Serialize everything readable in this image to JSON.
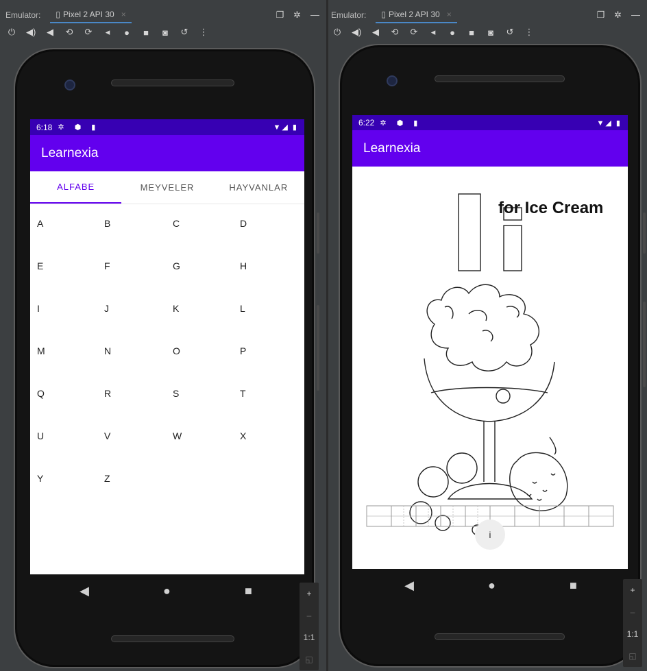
{
  "emulator_label": "Emulator:",
  "left": {
    "device_tab": "Pixel 2 API 30",
    "clock": "6:18",
    "app_title": "Learnexia",
    "tabs": [
      "ALFABE",
      "MEYVELER",
      "HAYVANLAR"
    ],
    "letters": [
      "A",
      "B",
      "C",
      "D",
      "E",
      "F",
      "G",
      "H",
      "I",
      "J",
      "K",
      "L",
      "M",
      "N",
      "O",
      "P",
      "Q",
      "R",
      "S",
      "T",
      "U",
      "V",
      "W",
      "X",
      "Y",
      "Z"
    ]
  },
  "right": {
    "device_tab": "Pixel 2 API 30",
    "clock": "6:22",
    "app_title": "Learnexia",
    "caption": "for Ice Cream",
    "fab_label": "i"
  },
  "zoom": {
    "plus": "+",
    "minus": "–",
    "one_to_one": "1:1"
  },
  "colors": {
    "status_bar": "#3700b3",
    "app_bar": "#6200ee",
    "accent": "#6200ee"
  }
}
